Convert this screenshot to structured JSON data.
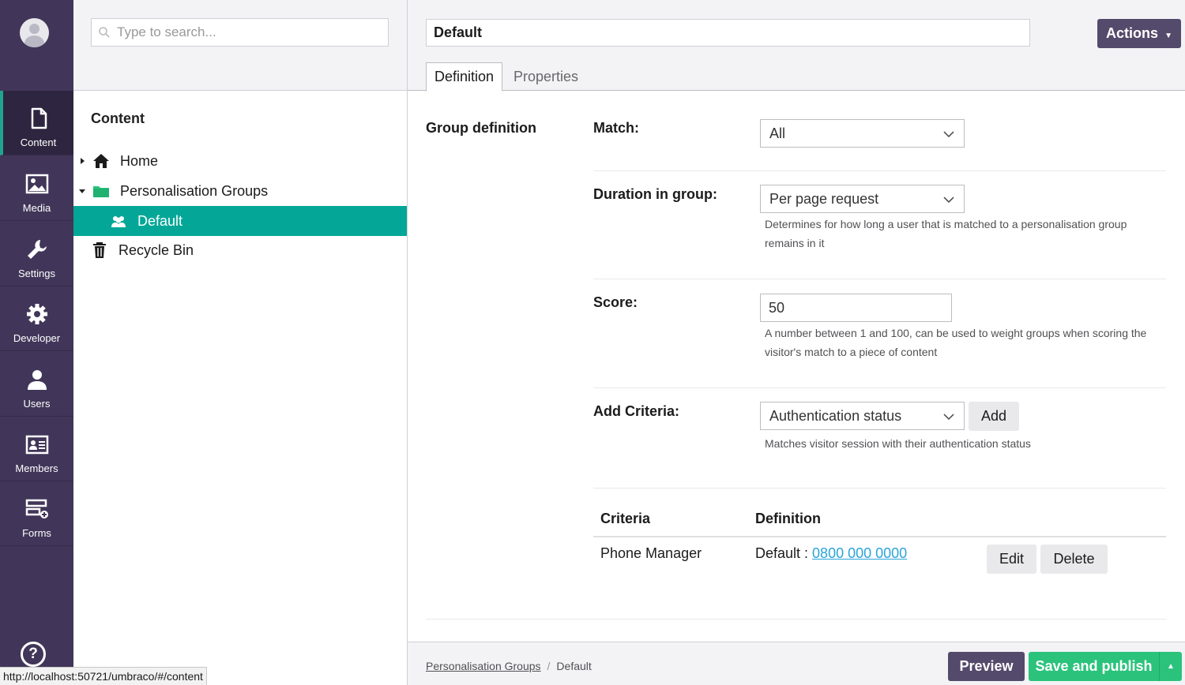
{
  "nav": {
    "items": [
      {
        "label": "Content",
        "icon": "document-icon"
      },
      {
        "label": "Media",
        "icon": "image-icon"
      },
      {
        "label": "Settings",
        "icon": "wrench-icon"
      },
      {
        "label": "Developer",
        "icon": "gear-icon"
      },
      {
        "label": "Users",
        "icon": "user-icon"
      },
      {
        "label": "Members",
        "icon": "id-card-icon"
      },
      {
        "label": "Forms",
        "icon": "forms-icon"
      }
    ],
    "help": "?"
  },
  "tree": {
    "search_placeholder": "Type to search...",
    "title": "Content",
    "items": [
      {
        "label": "Home"
      },
      {
        "label": "Personalisation Groups"
      },
      {
        "label": "Default"
      },
      {
        "label": "Recycle Bin"
      }
    ]
  },
  "editor": {
    "name": "Default",
    "actions_label": "Actions",
    "tabs": [
      {
        "label": "Definition"
      },
      {
        "label": "Properties"
      }
    ],
    "group_title": "Group definition",
    "match": {
      "label": "Match:",
      "value": "All"
    },
    "duration": {
      "label": "Duration in group:",
      "value": "Per page request",
      "desc": "Determines for how long a user that is matched to a personalisation group remains in it"
    },
    "score": {
      "label": "Score:",
      "value": "50",
      "desc": "A number between 1 and 100, can be used to weight groups when scoring the visitor's match to a piece of content"
    },
    "criteria": {
      "label": "Add Criteria:",
      "value": "Authentication status",
      "add_label": "Add",
      "desc": "Matches visitor session with their authentication status"
    },
    "table": {
      "headers": [
        "Criteria",
        "Definition"
      ],
      "rows": [
        {
          "criteria": "Phone Manager",
          "definition_prefix": "Default : ",
          "definition_link": "0800 000 0000",
          "edit": "Edit",
          "delete": "Delete"
        }
      ]
    }
  },
  "footer": {
    "breadcrumb": [
      "Personalisation Groups",
      "Default"
    ],
    "preview_label": "Preview",
    "publish_label": "Save and publish"
  },
  "statusbar": "http://localhost:50721/umbraco/#/content",
  "colors": {
    "nav_bg": "#413659",
    "accent_teal": "#04a797",
    "publish_green": "#2bc37c",
    "button_purple": "#544a6b",
    "link": "#2aa3d8"
  }
}
